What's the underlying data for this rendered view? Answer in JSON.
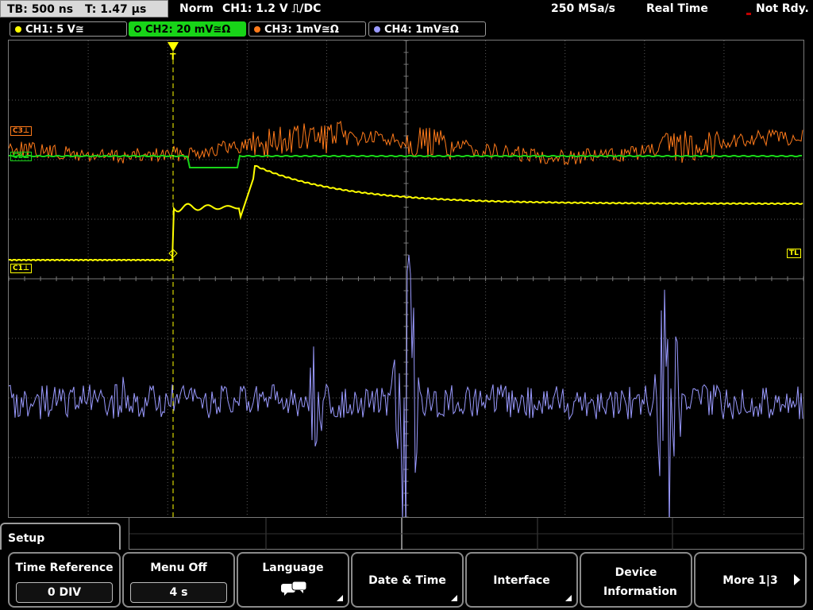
{
  "status_bar": {
    "timebase": "TB: 500 ns",
    "trigger_time": "T: 1.47 µs",
    "mode": "Norm",
    "trigger_info": "CH1: 1.2 V ⎍/DC",
    "sample_rate": "250 MSa/s",
    "acq_mode": "Real Time",
    "status": "Not Rdy."
  },
  "channels": [
    {
      "label": "CH1: 5 V≅",
      "color": "#ffff00",
      "active": false
    },
    {
      "label": "CH2: 20 mV≅Ω",
      "color": "#18d418",
      "active": true
    },
    {
      "label": "CH3: 1mV≅Ω",
      "color": "#ff7a1a",
      "active": false
    },
    {
      "label": "CH4: 1mV≅Ω",
      "color": "#9a9aff",
      "active": false
    }
  ],
  "markers": {
    "c1": "C1⊥",
    "c3": "C3⊥",
    "c2": "C2⊥",
    "tl": "TL",
    "trigger": "T"
  },
  "menu": {
    "title": "Setup",
    "softkeys": [
      {
        "label": "Time Reference",
        "value": "0 DIV"
      },
      {
        "label": "Menu Off",
        "value": "4 s"
      },
      {
        "label": "Language"
      },
      {
        "label": "Date & Time"
      },
      {
        "label": "Interface"
      },
      {
        "label": "Device Information"
      },
      {
        "label": "More 1|3"
      }
    ]
  },
  "colors": {
    "ch1": "#ffff00",
    "ch2": "#18d418",
    "ch3": "#ff7a1a",
    "ch4": "#9a9aff",
    "grid": "#5a5a5a"
  }
}
